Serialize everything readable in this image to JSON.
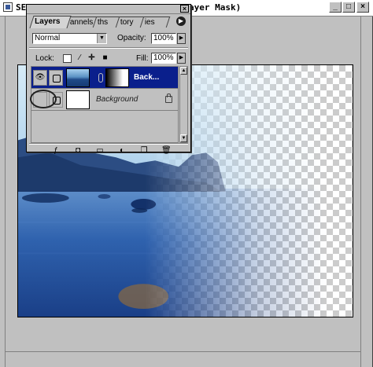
{
  "document": {
    "title_left": "SE",
    "title_right": "ayer Mask)",
    "controls": {
      "minimize": "_",
      "maximize": "□",
      "close": "×"
    }
  },
  "layers_palette": {
    "close": "×",
    "tabs": [
      {
        "label": "Layers",
        "active": true
      },
      {
        "label": "annels",
        "active": false
      },
      {
        "label": "ths",
        "active": false
      },
      {
        "label": "tory",
        "active": false
      },
      {
        "label": "ies",
        "active": false
      }
    ],
    "menu_arrow": "▶",
    "blend_mode": "Normal",
    "opacity_label": "Opacity:",
    "opacity_value": "100%",
    "lock_label": "Lock:",
    "fill_label": "Fill:",
    "fill_value": "100%",
    "layers": [
      {
        "name": "Back...",
        "selected": true,
        "visible": true,
        "has_mask": true
      },
      {
        "name": "Background",
        "selected": false,
        "visible": false,
        "locked": true
      }
    ]
  },
  "colors": {
    "selection": "#0a1f8c",
    "window_gray": "#c0c0c0",
    "water_blue": "#1f4f99"
  }
}
